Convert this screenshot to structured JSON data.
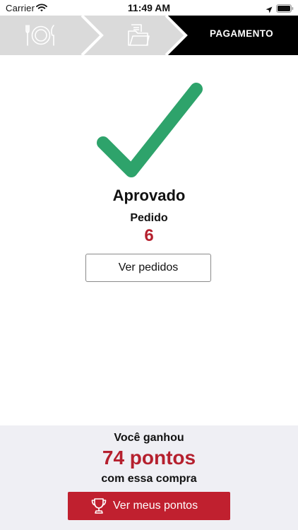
{
  "status_bar": {
    "carrier": "Carrier",
    "time": "11:49 AM",
    "icons": [
      "wifi-icon",
      "location-arrow-icon",
      "battery-icon"
    ]
  },
  "steps": [
    {
      "icon": "plate-cutlery-icon",
      "label": "",
      "state": "done"
    },
    {
      "icon": "folder-document-icon",
      "label": "",
      "state": "done"
    },
    {
      "icon": "",
      "label": "PAGAMENTO",
      "state": "active"
    }
  ],
  "result": {
    "icon": "checkmark-icon",
    "status": "Aprovado",
    "order_label": "Pedido",
    "order_number": "6",
    "orders_button": "Ver pedidos"
  },
  "rewards": {
    "earned_text": "Você ganhou",
    "points_text": "74 pontos",
    "purchase_text": "com essa compra",
    "button_label": "Ver meus pontos",
    "button_icon": "trophy-icon"
  },
  "colors": {
    "accent_red": "#c0202f",
    "success_green": "#2ea36b",
    "step_inactive": "#dadada",
    "step_active": "#000000",
    "panel_bg": "#efeff4"
  }
}
